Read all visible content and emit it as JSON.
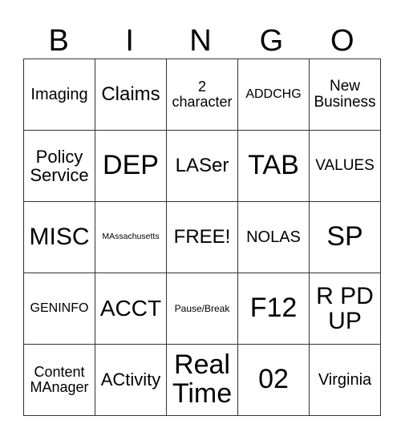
{
  "header": [
    "B",
    "I",
    "N",
    "G",
    "O"
  ],
  "grid": [
    [
      "Imaging",
      "Claims",
      "2 character",
      "ADDCHG",
      "New Business"
    ],
    [
      "Policy Service",
      "DEP",
      "LASer",
      "TAB",
      "VALUES"
    ],
    [
      "MISC",
      "MAssachusetts",
      "FREE!",
      "NOLAS",
      "SP"
    ],
    [
      "GENINFO",
      "ACCT",
      "Pause/Break",
      "F12",
      "R PD UP"
    ],
    [
      "Content MAnager",
      "ACtivity",
      "Real Time",
      "02",
      "Virginia"
    ]
  ]
}
